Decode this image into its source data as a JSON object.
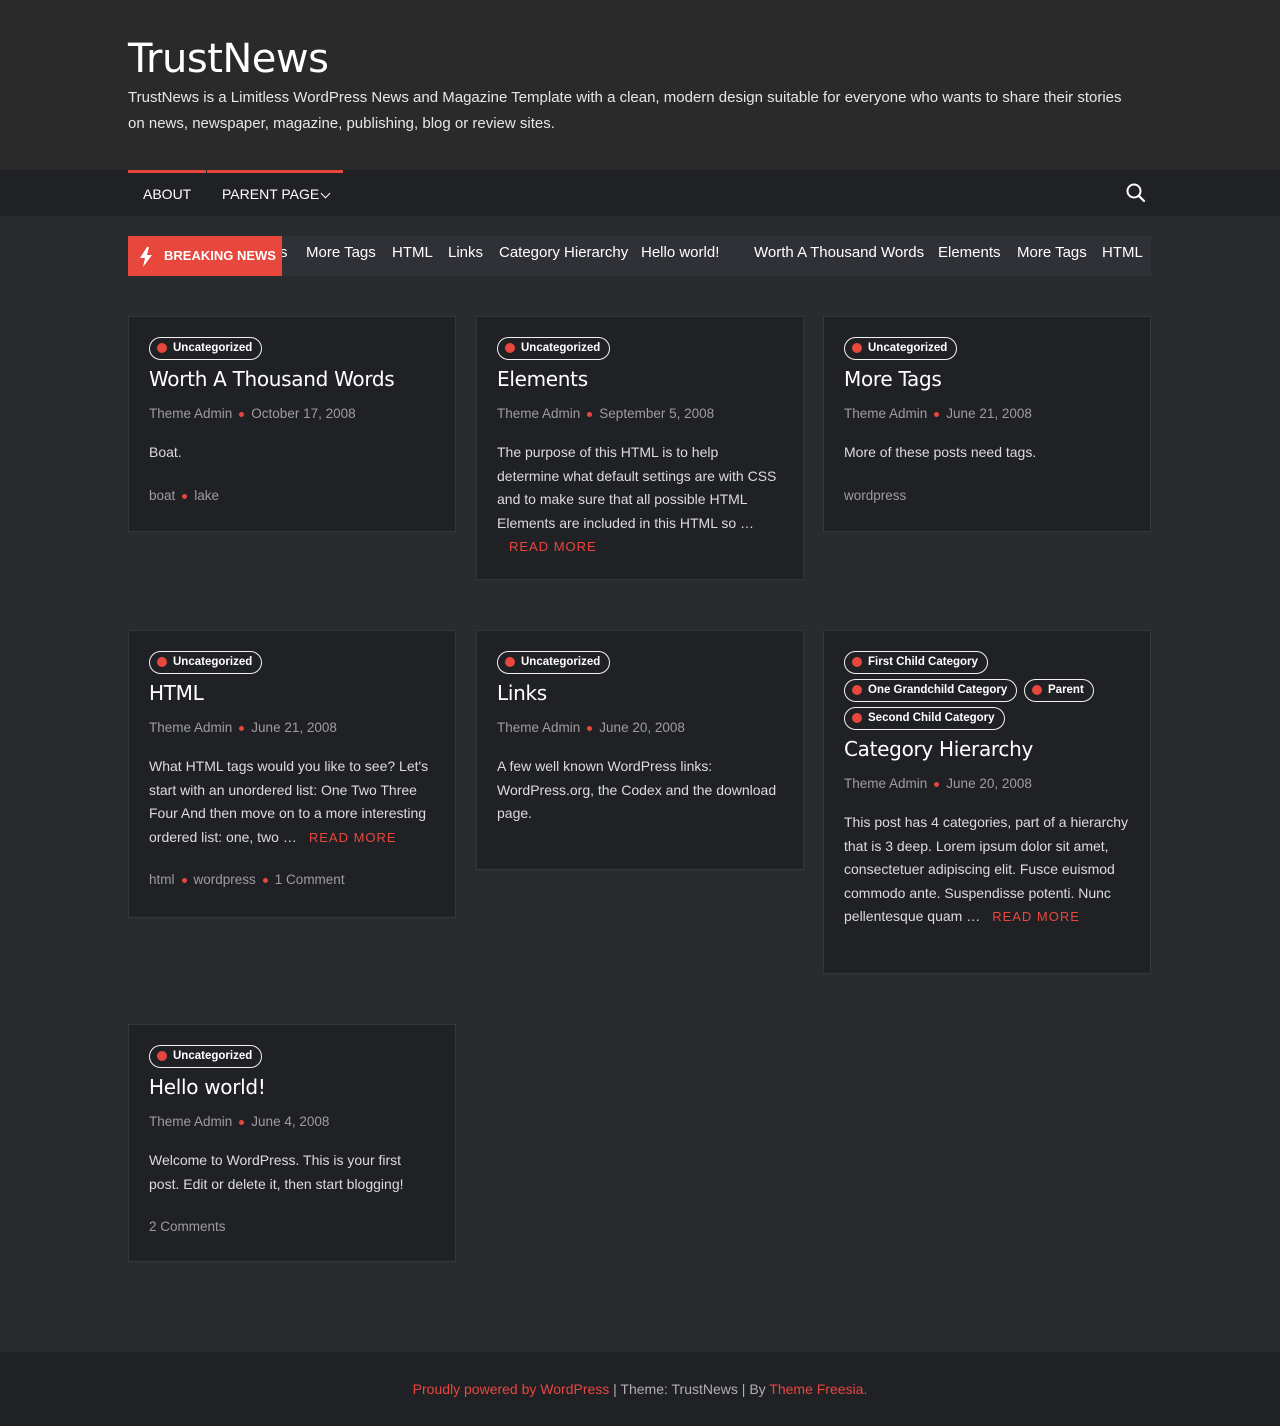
{
  "site": {
    "title": "TrustNews",
    "description": "TrustNews is a Limitless WordPress News and Magazine Template with a clean, modern design suitable for everyone who wants to share their stories on news, newspaper, magazine, publishing, blog or review sites."
  },
  "nav": {
    "about": "About",
    "parent_page": "Parent Page"
  },
  "ticker": {
    "label": "BREAKING NEWS",
    "items": [
      "s",
      "More Tags",
      "HTML",
      "Links",
      "Category Hierarchy",
      "Hello world!",
      "Worth A Thousand Words",
      "Elements",
      "More Tags",
      "HTML"
    ]
  },
  "icons": {
    "search": "search-icon",
    "bolt": "lightning-icon",
    "chevron": "chevron-down-icon"
  },
  "colors": {
    "accent": "#e8473e",
    "background": "#2a2b2f",
    "card": "#202125"
  },
  "posts": [
    {
      "category": "Uncategorized",
      "title": "Worth A Thousand Words",
      "author": "Theme Admin",
      "date": "October 17, 2008",
      "excerpt": "Boat.",
      "tags": [
        "boat",
        "lake"
      ]
    },
    {
      "category": "Uncategorized",
      "title": "Elements",
      "author": "Theme Admin",
      "date": "September 5, 2008",
      "excerpt": "The purpose of this HTML is to help determine what default settings are with CSS and to make sure that all possible HTML Elements are included in this HTML so …",
      "read_more": "Read More"
    },
    {
      "category": "Uncategorized",
      "title": "More Tags",
      "author": "Theme Admin",
      "date": "June 21, 2008",
      "excerpt": "More of these posts need tags.",
      "tags": [
        "wordpress"
      ]
    },
    {
      "category": "Uncategorized",
      "title": "HTML",
      "author": "Theme Admin",
      "date": "June 21, 2008",
      "excerpt": "What HTML tags would you like to see? Let's start with an unordered list: One Two Three Four And then move on to a more interesting ordered list: one, two …",
      "read_more": "Read More",
      "tags": [
        "html",
        "wordpress"
      ],
      "comments": "1 Comment"
    },
    {
      "category": "Uncategorized",
      "title": "Links",
      "author": "Theme Admin",
      "date": "June 20, 2008",
      "excerpt": "A few well known WordPress links: WordPress.org, the Codex and the download page."
    },
    {
      "categories": [
        "First Child Category",
        "One Grandchild Category",
        "Parent",
        "Second Child Category"
      ],
      "title": "Category Hierarchy",
      "author": "Theme Admin",
      "date": "June 20, 2008",
      "excerpt": "This post has 4 categories, part of a hierarchy that is 3 deep. Lorem ipsum dolor sit amet, consectetuer adipiscing elit. Fusce euismod commodo ante. Suspendisse potenti. Nunc pellentesque quam …",
      "read_more": "Read More"
    },
    {
      "category": "Uncategorized",
      "title": "Hello world!",
      "author": "Theme Admin",
      "date": "June 4, 2008",
      "excerpt": "Welcome to WordPress. This is your first post. Edit or delete it, then start blogging!",
      "comments": "2 Comments"
    }
  ],
  "footer": {
    "powered": "Proudly powered by WordPress",
    "sep1": " | Theme: TrustNews | By ",
    "author": "Theme Freesia."
  }
}
